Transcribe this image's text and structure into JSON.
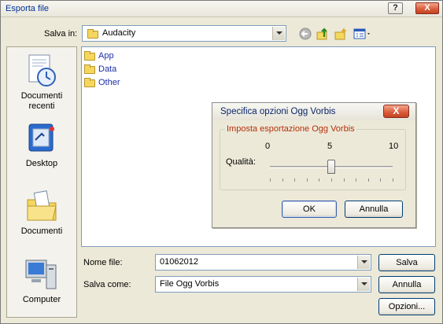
{
  "window": {
    "title": "Esporta file",
    "help_button": "?",
    "close_button": "X"
  },
  "toolbar": {
    "save_in_label": "Salva in:",
    "location": "Audacity",
    "back_icon": "back-arrow-icon",
    "up_icon": "up-folder-icon",
    "new_folder_icon": "new-folder-icon",
    "views_icon": "views-menu-icon"
  },
  "places": [
    {
      "label": "Documenti recenti",
      "icon": "recent-documents-icon"
    },
    {
      "label": "Desktop",
      "icon": "desktop-icon"
    },
    {
      "label": "Documenti",
      "icon": "my-documents-icon"
    },
    {
      "label": "Computer",
      "icon": "computer-icon"
    }
  ],
  "files": [
    "App",
    "Data",
    "Other"
  ],
  "form": {
    "filename_label": "Nome file:",
    "filename_value": "01062012",
    "saveas_label": "Salva come:",
    "saveas_value": "File Ogg Vorbis",
    "save_button": "Salva",
    "cancel_button": "Annulla",
    "options_button": "Opzioni..."
  },
  "dialog": {
    "title": "Specifica opzioni Ogg Vorbis",
    "close": "X",
    "group_caption": "Imposta esportazione Ogg Vorbis",
    "scale_min": "0",
    "scale_mid": "5",
    "scale_max": "10",
    "quality_label": "Qualità:",
    "quality": {
      "value": 5,
      "min": 0,
      "max": 10
    },
    "ok_button": "OK",
    "cancel_button": "Annulla"
  },
  "colors": {
    "window_bg": "#ece9d8",
    "link_blue": "#1c2fa8",
    "group_caption": "#b5300c",
    "close_red": "#d95a39"
  }
}
